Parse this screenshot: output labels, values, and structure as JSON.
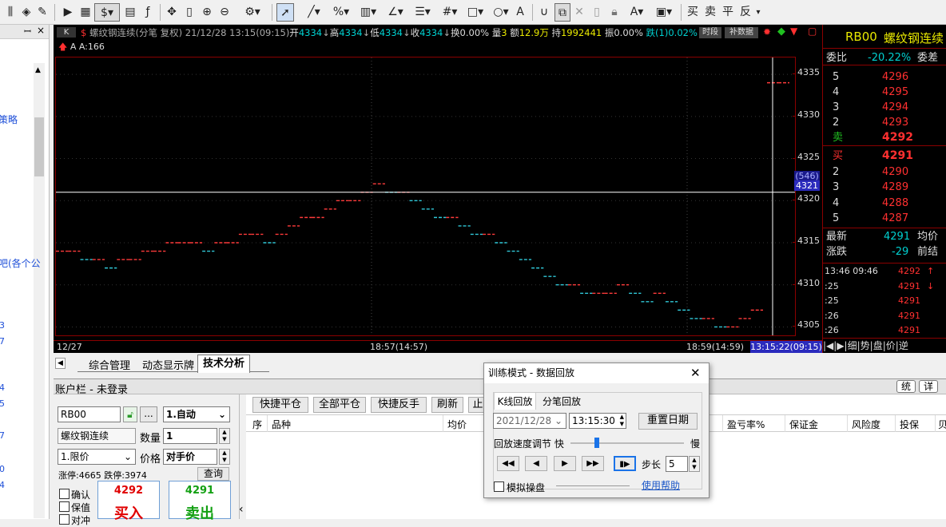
{
  "toolbar": {
    "dollar_label": "$",
    "pct_label": "%",
    "text_tool": "A",
    "order_buttons": [
      "买",
      "卖",
      "平",
      "反"
    ]
  },
  "left": {
    "frag_strategy": "策略",
    "frag_item": "吧(各个公",
    "digits": [
      "3",
      "7",
      "4",
      "5",
      "7",
      "0",
      "4"
    ]
  },
  "chart": {
    "tab_k": "K",
    "header": {
      "name": "螺纹钢连续(分笔 复权)",
      "datetime": "21/12/28 13:15(09:15)",
      "open_label": "开",
      "open": "4334",
      "high_label": "高",
      "high": "4334",
      "low_label": "低",
      "low": "4334",
      "close_label": "收",
      "close": "4334",
      "turnover_label": "换",
      "turnover": "0.00%",
      "vol_label": "量",
      "vol": "3",
      "amt_label": "额",
      "amt": "12.9万",
      "hold_label": "持",
      "hold": "1992441",
      "amp_label": "振",
      "amp": "0.00%",
      "chg_label": "跌(1)",
      "chg": "0.02%"
    },
    "btn_period": "时段",
    "btn_supplement": "补数据",
    "indicator": "A A:166",
    "crosshair_price": "4321",
    "crosshair_count": "(546)",
    "time_left": "12/27",
    "time_mid1": "18:57(14:57)",
    "time_mid2": "18:59(14:59)",
    "time_cursor": "13:15:22(09:15)",
    "chart_data": {
      "type": "line",
      "y_ticks": [
        4305,
        4310,
        4315,
        4320,
        4325,
        4330,
        4335
      ],
      "ylim": [
        4304,
        4337
      ],
      "series": [
        {
          "name": "price",
          "values": [
            4314,
            4314,
            4313,
            4313,
            4312,
            4313,
            4313,
            4314,
            4314,
            4315,
            4315,
            4315,
            4314,
            4315,
            4315,
            4316,
            4316,
            4315,
            4316,
            4317,
            4318,
            4318,
            4319,
            4320,
            4320,
            4321,
            4322,
            4321,
            4321,
            4320,
            4319,
            4318,
            4318,
            4317,
            4316,
            4316,
            4315,
            4314,
            4313,
            4312,
            4311,
            4310,
            4310,
            4309,
            4309,
            4309,
            4310,
            4309,
            4308,
            4309,
            4308,
            4307,
            4306,
            4306,
            4305,
            4305,
            4306,
            4307,
            4334,
            4334
          ]
        }
      ]
    }
  },
  "quote": {
    "symbol": "RB00",
    "name": "螺纹钢连续",
    "weibi_label": "委比",
    "weibi": "-20.22%",
    "weicha_label": "委差",
    "asks": [
      {
        "lvl": "5",
        "p": "4296"
      },
      {
        "lvl": "4",
        "p": "4295"
      },
      {
        "lvl": "3",
        "p": "4294"
      },
      {
        "lvl": "2",
        "p": "4293"
      },
      {
        "lvl": "卖",
        "p": "4292"
      }
    ],
    "bids": [
      {
        "lvl": "买",
        "p": "4291"
      },
      {
        "lvl": "2",
        "p": "4290"
      },
      {
        "lvl": "3",
        "p": "4289"
      },
      {
        "lvl": "4",
        "p": "4288"
      },
      {
        "lvl": "5",
        "p": "4287"
      }
    ],
    "last_label": "最新",
    "last": "4291",
    "avg_label": "均价",
    "chg_label": "涨跌",
    "chg": "-29",
    "prev_label": "前结",
    "ticks": [
      {
        "t": "13:46 09:46",
        "p": "4292",
        "a": "↑"
      },
      {
        "t": ":25",
        "p": "4291",
        "a": "↓"
      },
      {
        "t": ":25",
        "p": "4291",
        "a": ""
      },
      {
        "t": ":26",
        "p": "4291",
        "a": ""
      },
      {
        "t": ":26",
        "p": "4291",
        "a": ""
      }
    ],
    "bottom_tabs": [
      "细",
      "势",
      "盘",
      "价",
      "逆"
    ]
  },
  "tabs": [
    "综合管理",
    "动态显示牌",
    "技术分析"
  ],
  "account": {
    "title": "账户栏 - 未登录",
    "btn1": "统",
    "btn2": "详"
  },
  "order": {
    "code": "RB00",
    "name": "螺纹钢连续",
    "mode": "1.自动",
    "qty_label": "数量",
    "qty": "1",
    "type": "1.限价",
    "price_label": "价格",
    "price": "对手价",
    "limits": "涨停:4665 跌停:3974",
    "query": "查询",
    "confirm": "确认",
    "keep": "保值",
    "other": "对冲",
    "sell_price": "4292",
    "buy_price": "4291",
    "buy": "买入",
    "sell": "卖出"
  },
  "actions": [
    "快捷平仓",
    "全部平仓",
    "快捷反手",
    "刷新",
    "止"
  ],
  "table": {
    "cols": [
      "序",
      "品种",
      "均价",
      "盈亏率%",
      "保证金",
      "风险度",
      "投保",
      "贝"
    ]
  },
  "dialog": {
    "title": "训练模式 - 数据回放",
    "tab_k": "K线回放",
    "tab_tick": "分笔回放",
    "date": "2021/12/28",
    "time": "13:15:30",
    "reset": "重置日期",
    "speed_label": "回放速度调节",
    "fast": "快",
    "slow": "慢",
    "step_label": "步长",
    "step": "5",
    "sim": "模拟操盘",
    "help": "使用帮助"
  }
}
